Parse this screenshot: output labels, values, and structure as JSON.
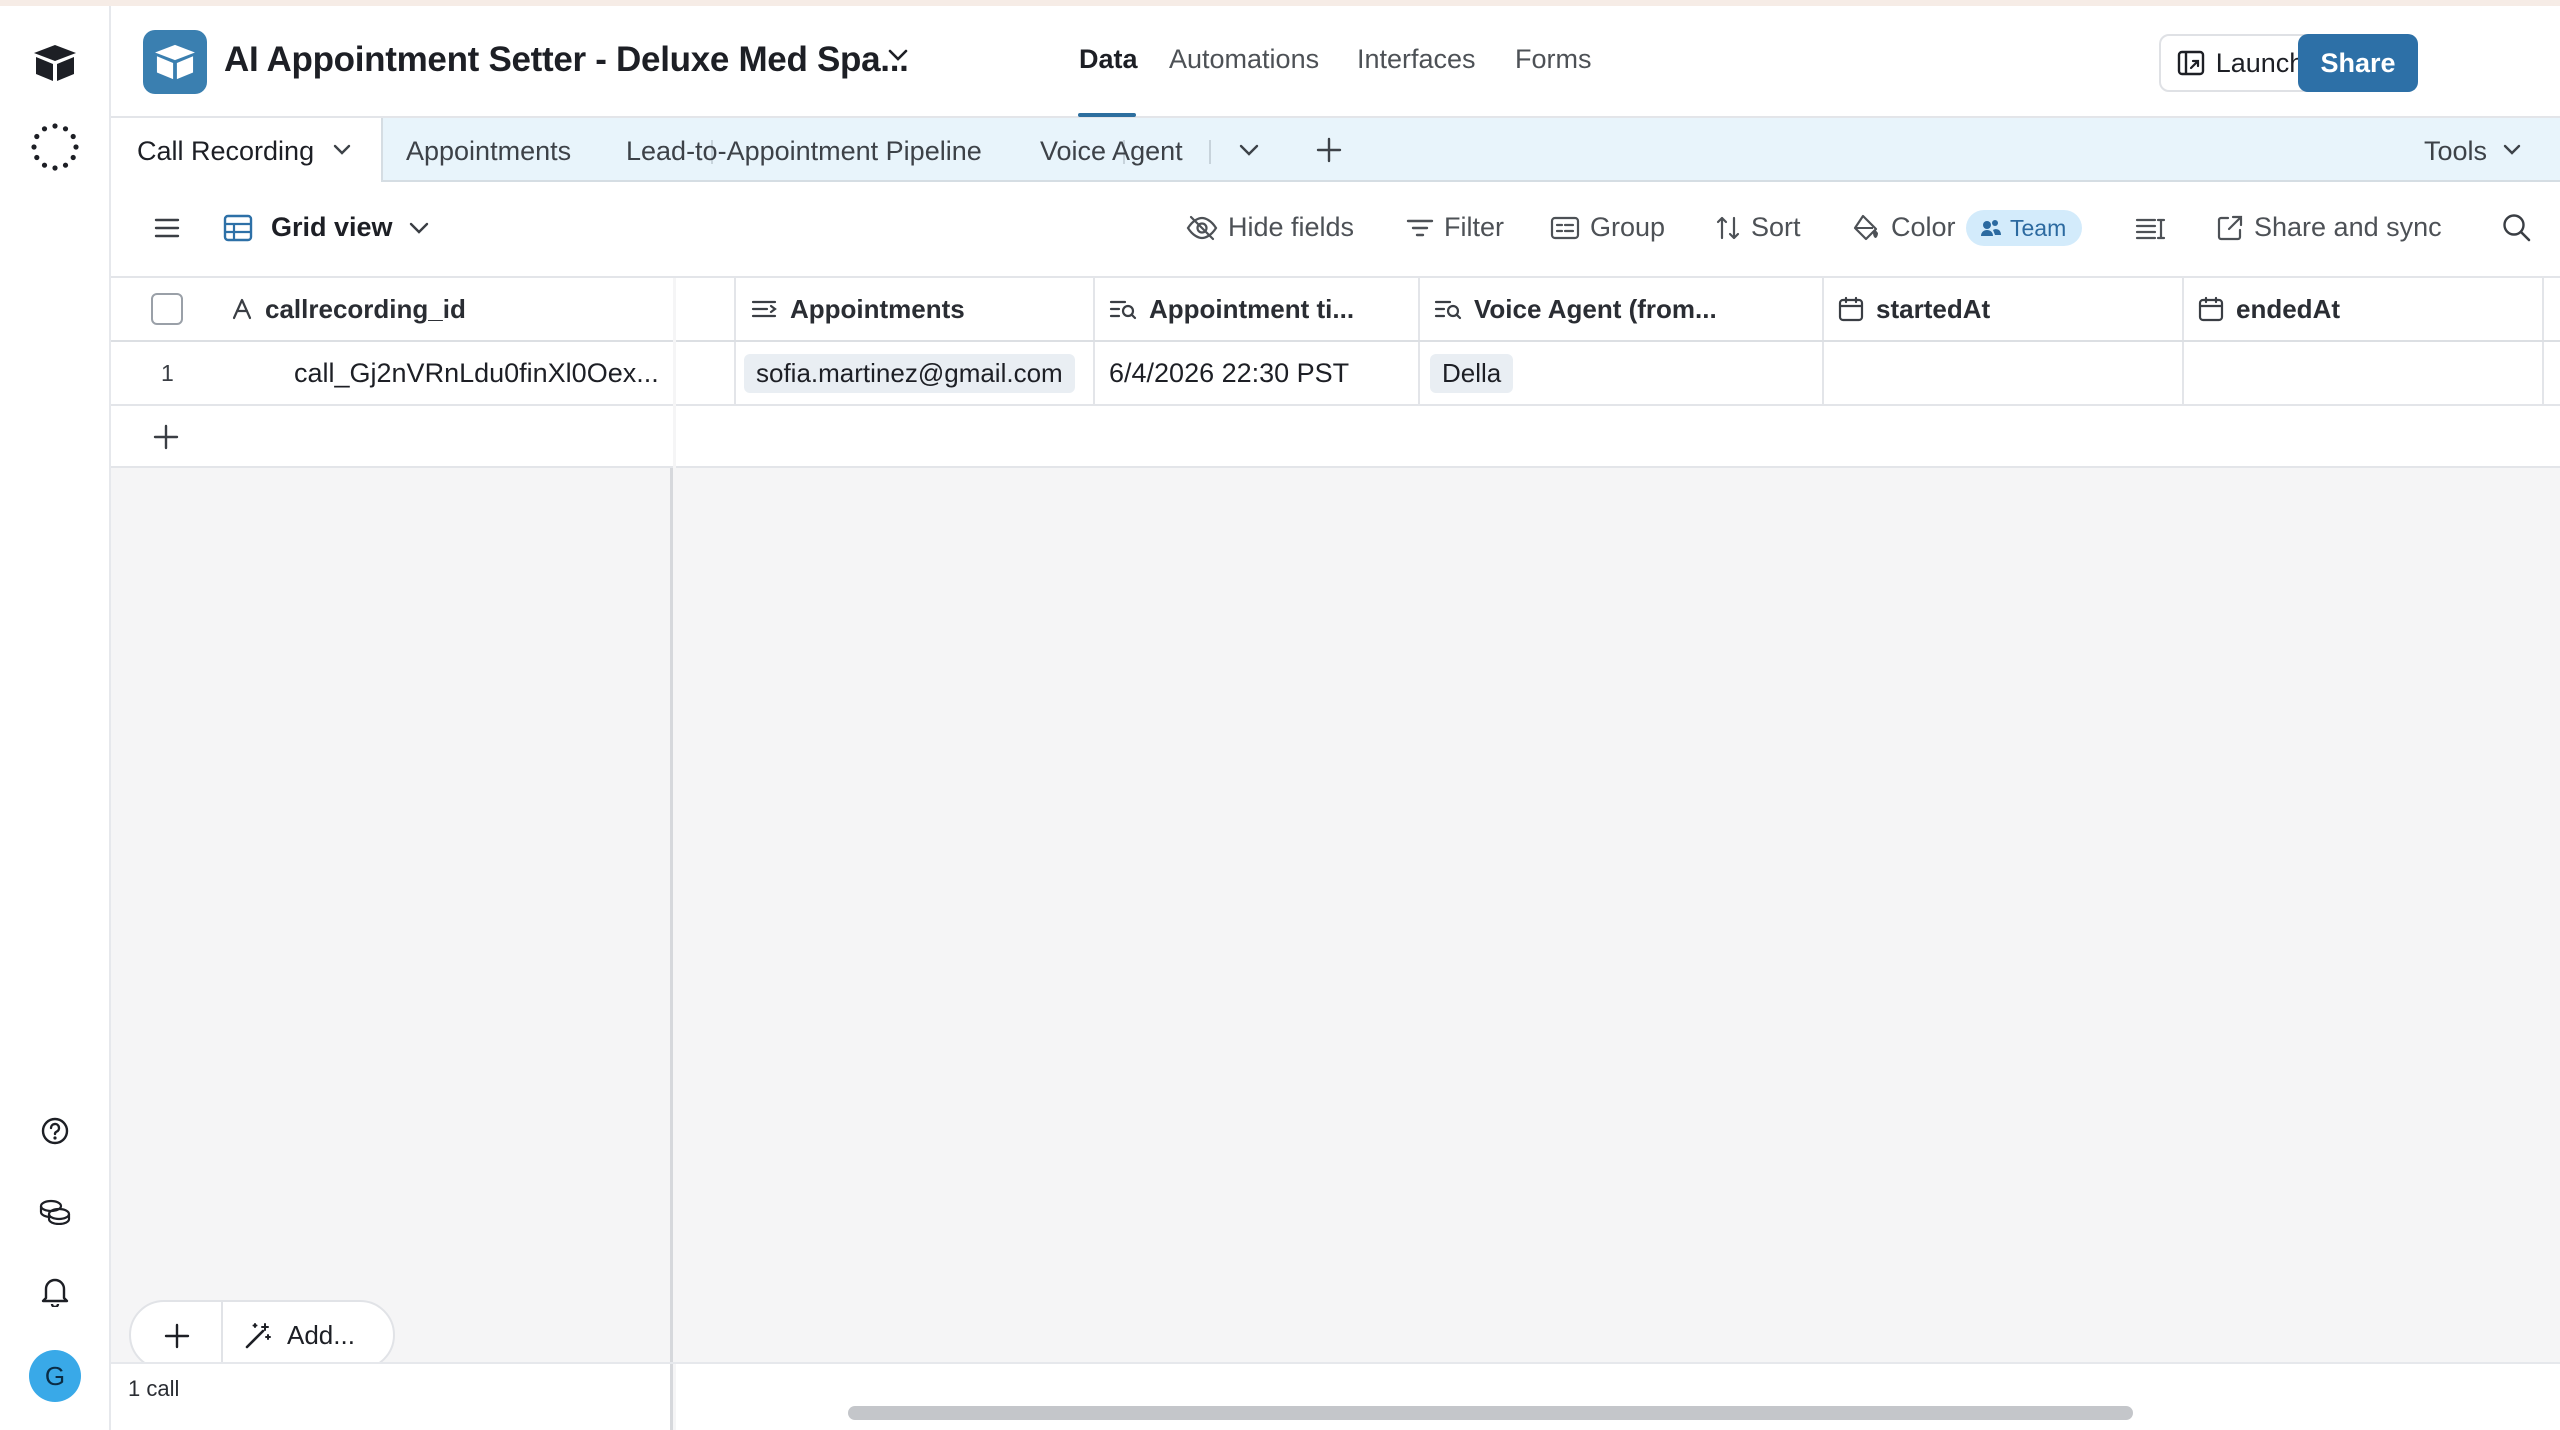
{
  "app": {
    "base_title": "AI Appointment Setter - Deluxe Med Spa...",
    "nav_tabs": [
      "Data",
      "Automations",
      "Interfaces",
      "Forms"
    ],
    "launch_label": "Launch",
    "share_label": "Share"
  },
  "tables": {
    "active": "Call Recording",
    "others": [
      "Appointments",
      "Lead-to-Appointment Pipeline",
      "Voice Agent"
    ],
    "tools_label": "Tools"
  },
  "view": {
    "name": "Grid view",
    "hide_fields": "Hide fields",
    "filter": "Filter",
    "group": "Group",
    "sort": "Sort",
    "color": "Color",
    "team_badge": "Team",
    "share_sync": "Share and sync"
  },
  "grid": {
    "primary_header": "callrecording_id",
    "headers": [
      "Appointments",
      "Appointment ti...",
      "Voice Agent (from...",
      "startedAt",
      "endedAt"
    ],
    "row_number": "1",
    "row": {
      "id": "call_Gj2nVRnLdu0finXl0Oex...",
      "appointment": "sofia.martinez@gmail.com",
      "appointment_time": "6/4/2026 22:30 PST",
      "voice_agent": "Della",
      "startedAt": "",
      "endedAt": ""
    },
    "add_label": "Add...",
    "record_count": "1 call"
  },
  "colors": {
    "accent": "#2d70a7",
    "tabbar_bg": "#e8f4fb",
    "team_pill_bg": "#d3ebfb",
    "avatar": "#39a9e8"
  },
  "avatar_initial": "G",
  "icons": [
    "airtable-cube-icon",
    "loading-ring-icon",
    "help-icon",
    "coins-icon",
    "bell-icon",
    "history-icon",
    "link-icon",
    "search-icon"
  ]
}
